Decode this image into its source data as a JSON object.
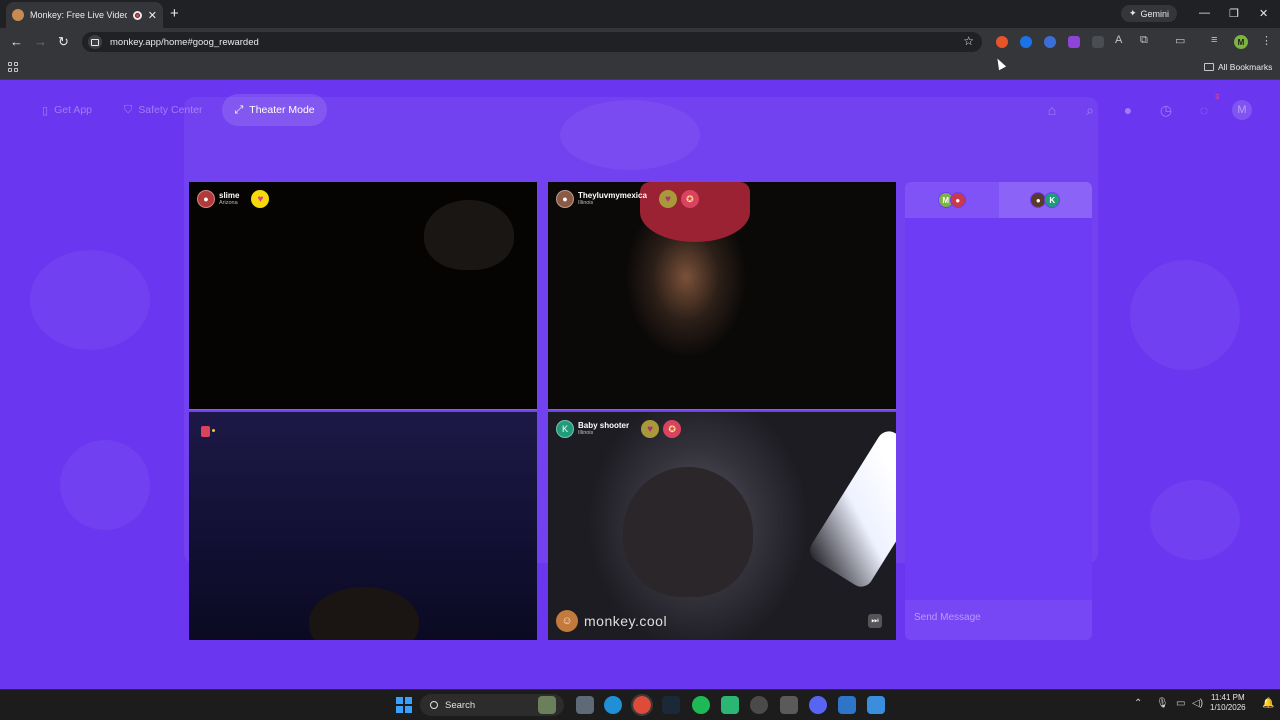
{
  "browser": {
    "tab_title": "Monkey: Free Live Video Ch",
    "tab_close": "✕",
    "new_tab": "+",
    "gemini_label": "Gemini",
    "url": "monkey.app/home#goog_rewarded",
    "all_bookmarks": "All Bookmarks",
    "profile_initial": "M"
  },
  "app": {
    "nav": [
      {
        "label": "Get App",
        "icon": "phone-icon"
      },
      {
        "label": "Safety Center",
        "icon": "shield-icon"
      },
      {
        "label": "Theater Mode",
        "icon": "expand-icon"
      }
    ],
    "header_right": {
      "avatar_initial": "M",
      "notification_count": "3"
    },
    "videos": [
      {
        "name": "slime",
        "location": "Arizona"
      },
      {
        "name": "Theyluvmymexica",
        "location": "Illinois"
      },
      {
        "name": "",
        "location": ""
      },
      {
        "name": "Baby shooter",
        "location": "Illinois",
        "avatar_initial": "K"
      }
    ],
    "watermark": "monkey.cool",
    "chat": {
      "tab_left_initial": "M",
      "tab_right_initial": "K",
      "send_placeholder": "Send Message"
    }
  },
  "taskbar": {
    "search_label": "Search",
    "time": "11:41 PM",
    "date": "1/10/2026"
  },
  "colors": {
    "page_bg": "#6a36f0",
    "chat_bg": "#6f3cf5",
    "heart_bg": "#f5d90a",
    "medal_bg": "#d9435f"
  }
}
